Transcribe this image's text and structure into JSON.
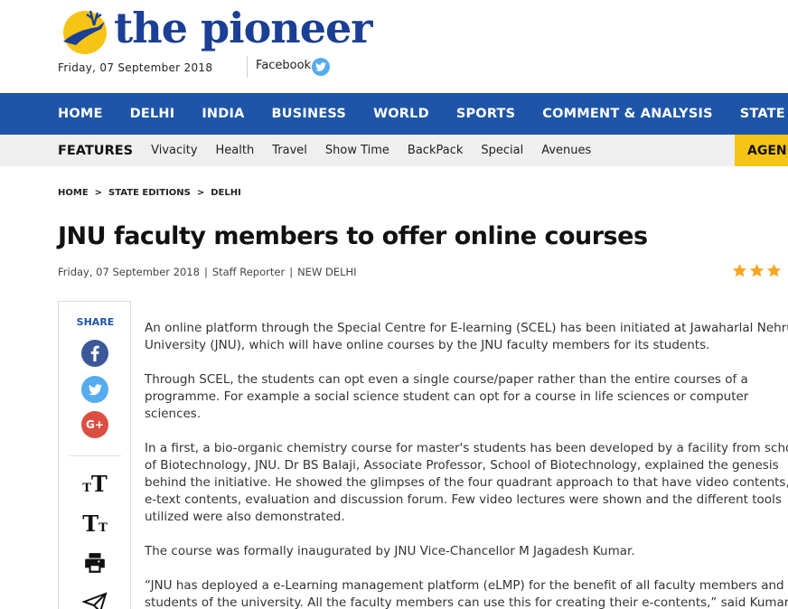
{
  "site": {
    "logo_text": "the pioneer",
    "date": "Friday, 07 September 2018",
    "facebook_label": "Facebook"
  },
  "main_nav": [
    "HOME",
    "DELHI",
    "INDIA",
    "BUSINESS",
    "WORLD",
    "SPORTS",
    "COMMENT & ANALYSIS",
    "STATE EDITIONS"
  ],
  "sub_nav": {
    "features_label": "FEATURES",
    "items": [
      "Vivacity",
      "Health",
      "Travel",
      "Show Time",
      "BackPack",
      "Special",
      "Avenues"
    ],
    "agenda_label": "AGENDA"
  },
  "breadcrumb": [
    "HOME",
    "STATE EDITIONS",
    "DELHI"
  ],
  "article": {
    "title": "JNU faculty members to offer online courses",
    "date": "Friday, 07 September 2018",
    "author": "Staff Reporter",
    "location": "NEW DELHI",
    "rating_stars": 3,
    "paragraphs": [
      "An online platform through the Special Centre for E-learning (SCEL) has been initiated at Jawaharlal Nehru University (JNU), which will have online courses by the JNU faculty members for its students.",
      "Through SCEL, the students can opt even a single course/paper rather than the entire courses of a programme. For example a social science student can opt for a course in life sciences or computer sciences.",
      "In a first, a bio-organic chemistry course for master's students has been developed by a facility from school of Biotechnology, JNU. Dr BS Balaji, Associate Professor, School of Biotechnology, explained the genesis behind the initiative. He showed the glimpses of the four quadrant approach to that have video contents, e-text contents, evaluation and discussion forum. Few video lectures were shown and the different tools utilized were also demonstrated.",
      "The course was formally inaugurated by JNU Vice-Chancellor M Jagadesh Kumar.",
      "“JNU has deployed a e-Learning management platform (eLMP) for the benefit of all faculty members and students of the university. All the faculty members can use this for creating their e-contents,” said Kumar."
    ]
  },
  "share": {
    "label": "SHARE",
    "facebook_color": "#3b5998",
    "twitter_color": "#55acee",
    "google_color": "#dc4e41",
    "google_text": "G+"
  },
  "tools": {
    "increase_font": "TT",
    "decrease_font": "TT"
  },
  "colors": {
    "brand_blue": "#1e55a8",
    "agenda_yellow": "#f6c414",
    "star_orange": "#f5a623"
  }
}
